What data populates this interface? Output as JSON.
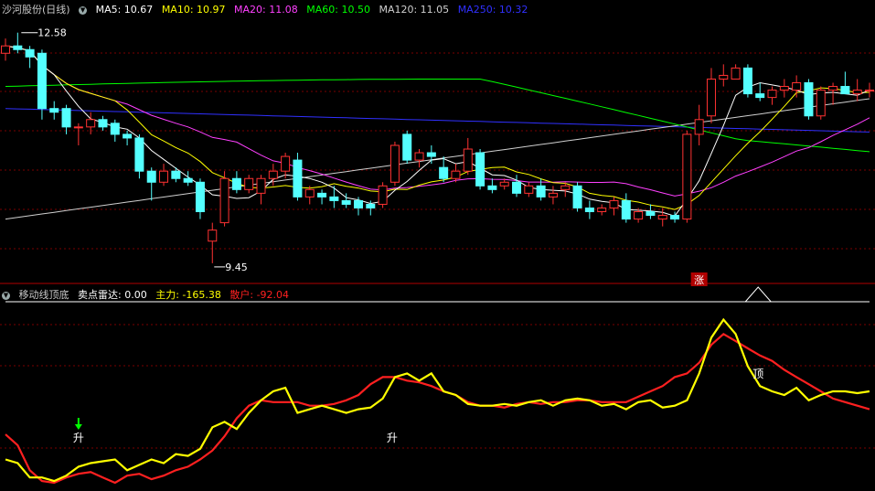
{
  "main_panel": {
    "stock_name": "沙河股份(日线)",
    "ma_legend": [
      {
        "label": "MA5: 10.67",
        "color": "#ffffff"
      },
      {
        "label": "MA10: 10.97",
        "color": "#ffff00"
      },
      {
        "label": "MA20: 11.08",
        "color": "#ff40ff"
      },
      {
        "label": "MA60: 10.50",
        "color": "#00ff00"
      },
      {
        "label": "MA120: 11.05",
        "color": "#cfcfcf"
      },
      {
        "label": "MA250: 10.32",
        "color": "#3030ff"
      }
    ],
    "high_label": "12.58",
    "low_label": "9.45",
    "limit_up_mark": "涨"
  },
  "indicator_panel": {
    "name": "移动线顶底",
    "legend": [
      {
        "label": "卖点雷达: 0.00",
        "color": "#ffffff"
      },
      {
        "label": "主力: -165.38",
        "color": "#ffff00"
      },
      {
        "label": "散户: -92.04",
        "color": "#ff2020"
      }
    ],
    "rise_label": "升",
    "top_label": "顶"
  },
  "chart_data": [
    {
      "type": "candlestick",
      "title": "沙河股份(日线)",
      "candles": [
        [
          12.3,
          12.5,
          12.2,
          12.4
        ],
        [
          12.4,
          12.58,
          12.3,
          12.35
        ],
        [
          12.35,
          12.4,
          12.1,
          12.25
        ],
        [
          12.3,
          12.35,
          11.4,
          11.55
        ],
        [
          11.55,
          11.65,
          11.4,
          11.5
        ],
        [
          11.55,
          11.6,
          11.2,
          11.3
        ],
        [
          11.3,
          11.35,
          11.05,
          11.3
        ],
        [
          11.3,
          11.5,
          11.2,
          11.4
        ],
        [
          11.4,
          11.45,
          11.25,
          11.3
        ],
        [
          11.35,
          11.4,
          11.1,
          11.2
        ],
        [
          11.2,
          11.25,
          11.05,
          11.15
        ],
        [
          11.15,
          11.2,
          10.6,
          10.7
        ],
        [
          10.7,
          10.75,
          10.3,
          10.55
        ],
        [
          10.55,
          10.8,
          10.5,
          10.7
        ],
        [
          10.7,
          10.75,
          10.55,
          10.6
        ],
        [
          10.6,
          10.7,
          10.5,
          10.55
        ],
        [
          10.55,
          10.6,
          10.05,
          10.15
        ],
        [
          9.75,
          10.0,
          9.45,
          9.9
        ],
        [
          10.0,
          10.7,
          9.95,
          10.6
        ],
        [
          10.6,
          10.7,
          10.4,
          10.45
        ],
        [
          10.45,
          10.65,
          10.4,
          10.6
        ],
        [
          10.4,
          10.65,
          10.25,
          10.6
        ],
        [
          10.6,
          10.8,
          10.5,
          10.7
        ],
        [
          10.7,
          10.95,
          10.6,
          10.9
        ],
        [
          10.85,
          10.95,
          10.3,
          10.35
        ],
        [
          10.35,
          10.5,
          10.25,
          10.45
        ],
        [
          10.4,
          10.45,
          10.25,
          10.35
        ],
        [
          10.35,
          10.5,
          10.2,
          10.3
        ],
        [
          10.3,
          10.4,
          10.2,
          10.25
        ],
        [
          10.3,
          10.35,
          10.1,
          10.2
        ],
        [
          10.25,
          10.3,
          10.1,
          10.2
        ],
        [
          10.25,
          10.55,
          10.2,
          10.5
        ],
        [
          10.55,
          11.1,
          10.5,
          11.05
        ],
        [
          11.2,
          11.25,
          10.8,
          10.85
        ],
        [
          10.85,
          11.0,
          10.75,
          10.95
        ],
        [
          10.95,
          11.05,
          10.8,
          10.9
        ],
        [
          10.75,
          10.9,
          10.55,
          10.6
        ],
        [
          10.6,
          10.8,
          10.55,
          10.7
        ],
        [
          10.7,
          11.15,
          10.65,
          11.0
        ],
        [
          10.95,
          11.0,
          10.45,
          10.5
        ],
        [
          10.5,
          10.6,
          10.4,
          10.45
        ],
        [
          10.5,
          10.6,
          10.45,
          10.55
        ],
        [
          10.55,
          10.65,
          10.35,
          10.4
        ],
        [
          10.4,
          10.55,
          10.35,
          10.5
        ],
        [
          10.5,
          10.6,
          10.3,
          10.35
        ],
        [
          10.35,
          10.5,
          10.25,
          10.4
        ],
        [
          10.45,
          10.55,
          10.35,
          10.5
        ],
        [
          10.5,
          10.55,
          10.15,
          10.2
        ],
        [
          10.2,
          10.3,
          10.05,
          10.15
        ],
        [
          10.15,
          10.25,
          10.1,
          10.2
        ],
        [
          10.2,
          10.35,
          10.1,
          10.3
        ],
        [
          10.3,
          10.4,
          10.0,
          10.05
        ],
        [
          10.05,
          10.2,
          10.0,
          10.15
        ],
        [
          10.15,
          10.25,
          10.05,
          10.1
        ],
        [
          10.05,
          10.2,
          9.95,
          10.1
        ],
        [
          10.1,
          10.15,
          10.0,
          10.05
        ],
        [
          10.05,
          11.25,
          10.0,
          11.2
        ],
        [
          11.2,
          11.6,
          11.05,
          11.4
        ],
        [
          11.45,
          12.1,
          11.35,
          11.95
        ],
        [
          11.95,
          12.15,
          11.85,
          12.0
        ],
        [
          11.95,
          12.15,
          11.95,
          12.1
        ],
        [
          12.1,
          12.15,
          11.7,
          11.75
        ],
        [
          11.75,
          11.9,
          11.65,
          11.7
        ],
        [
          11.7,
          11.85,
          11.6,
          11.8
        ],
        [
          11.8,
          11.95,
          11.7,
          11.85
        ],
        [
          11.8,
          12.0,
          11.7,
          11.9
        ],
        [
          11.9,
          11.95,
          11.4,
          11.45
        ],
        [
          11.45,
          11.85,
          11.4,
          11.8
        ],
        [
          11.8,
          11.9,
          11.6,
          11.85
        ],
        [
          11.85,
          12.05,
          11.75,
          11.75
        ],
        [
          11.75,
          11.95,
          11.65,
          11.8
        ],
        [
          11.8,
          11.9,
          11.7,
          11.8
        ]
      ],
      "high_marker": 12.58,
      "low_marker": 9.45,
      "limit_up_index": 57
    },
    {
      "type": "line",
      "title": "移动线顶底",
      "series": [
        {
          "name": "主力",
          "color": "#ffff00",
          "values": [
            -88,
            -90,
            -98,
            -98,
            -100,
            -97,
            -92,
            -90,
            -89,
            -88,
            -94,
            -91,
            -88,
            -90,
            -85,
            -86,
            -82,
            -70,
            -67,
            -71,
            -62,
            -55,
            -50,
            -48,
            -62,
            -60,
            -58,
            -60,
            -62,
            -60,
            -59,
            -54,
            -42,
            -40,
            -44,
            -40,
            -50,
            -52,
            -57,
            -58,
            -58,
            -57,
            -58,
            -56,
            -55,
            -58,
            -55,
            -54,
            -55,
            -58,
            -57,
            -60,
            -56,
            -55,
            -59,
            -58,
            -55,
            -40,
            -20,
            -10,
            -18,
            -36,
            -47,
            -50,
            -52,
            -48,
            -55,
            -52,
            -50,
            -50,
            -51,
            -50
          ]
        },
        {
          "name": "散户",
          "color": "#ff2020",
          "values": [
            -74,
            -80,
            -94,
            -100,
            -101,
            -98,
            -96,
            -95,
            -98,
            -101,
            -97,
            -96,
            -99,
            -97,
            -94,
            -92,
            -88,
            -83,
            -75,
            -65,
            -58,
            -55,
            -56,
            -56,
            -56,
            -58,
            -58,
            -57,
            -55,
            -52,
            -46,
            -42,
            -42,
            -44,
            -45,
            -47,
            -50,
            -52,
            -56,
            -58,
            -58,
            -59,
            -57,
            -56,
            -57,
            -56,
            -56,
            -55,
            -55,
            -56,
            -56,
            -56,
            -53,
            -50,
            -47,
            -42,
            -40,
            -34,
            -24,
            -18,
            -22,
            -26,
            -30,
            -33,
            -38,
            -42,
            -46,
            -50,
            -54,
            -56,
            -58,
            -60
          ]
        },
        {
          "name": "卖点雷达",
          "color": "#ffffff",
          "values": [
            0,
            0,
            0,
            0,
            0,
            0,
            0,
            0,
            0,
            0,
            0,
            0,
            0,
            0,
            0,
            0,
            0,
            0,
            0,
            0,
            0,
            0,
            0,
            0,
            0,
            0,
            0,
            0,
            0,
            0,
            0,
            0,
            0,
            0,
            0,
            0,
            0,
            0,
            0,
            0,
            0,
            0,
            0,
            0,
            0,
            0,
            0,
            0,
            0,
            0,
            0,
            0,
            0,
            0,
            0,
            0,
            0,
            0,
            0,
            0,
            0,
            0,
            0,
            0,
            0,
            0,
            0,
            0,
            0,
            0,
            0,
            0
          ]
        }
      ],
      "ylim": [
        -102,
        0
      ]
    }
  ]
}
